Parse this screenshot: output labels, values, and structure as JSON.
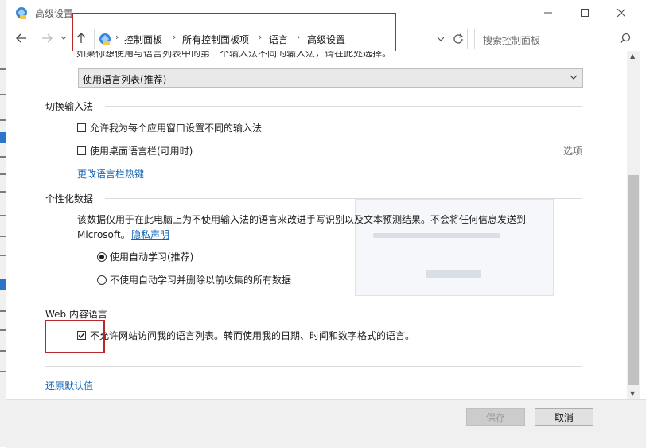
{
  "window": {
    "title": "高级设置"
  },
  "address_bar": {
    "crumbs": [
      "控制面板",
      "所有控制面板项",
      "语言",
      "高级设置"
    ]
  },
  "search": {
    "placeholder": "搜索控制面板"
  },
  "partial_top_text": "如果你想使用与语言列表中的第一个输入法不同的输入法，请在此处选择。",
  "dropdown": {
    "value": "使用语言列表(推荐)"
  },
  "input_switch": {
    "title": "切换输入法",
    "per_app_checkbox": {
      "label": "允许我为每个应用窗口设置不同的输入法",
      "checked": false
    },
    "desktop_bar_checkbox": {
      "label": "使用桌面语言栏(可用时)",
      "checked": false
    },
    "options_link": "选项",
    "hotkey_link": "更改语言栏热键"
  },
  "personalization": {
    "title": "个性化数据",
    "desc_line1": "该数据仅用于在此电脑上为不使用输入法的语言来改进手写识别以及文本预测结果。不会将任何信息发送到",
    "desc_line2": "Microsoft。",
    "privacy_link": "隐私声明",
    "radio_auto": {
      "label": "使用自动学习(推荐)",
      "selected": true
    },
    "radio_no_auto": {
      "label": "不使用自动学习并删除以前收集的所有数据",
      "selected": false
    }
  },
  "web_content": {
    "title": "Web 内容语言",
    "checkbox": {
      "label": "不允许网站访问我的语言列表。转而使用我的日期、时间和数字格式的语言。",
      "checked": true
    }
  },
  "restore_link": "还原默认值",
  "buttons": {
    "save": "保存",
    "cancel": "取消"
  },
  "colors": {
    "highlight": "#b8262a",
    "link": "#0f64b6"
  }
}
